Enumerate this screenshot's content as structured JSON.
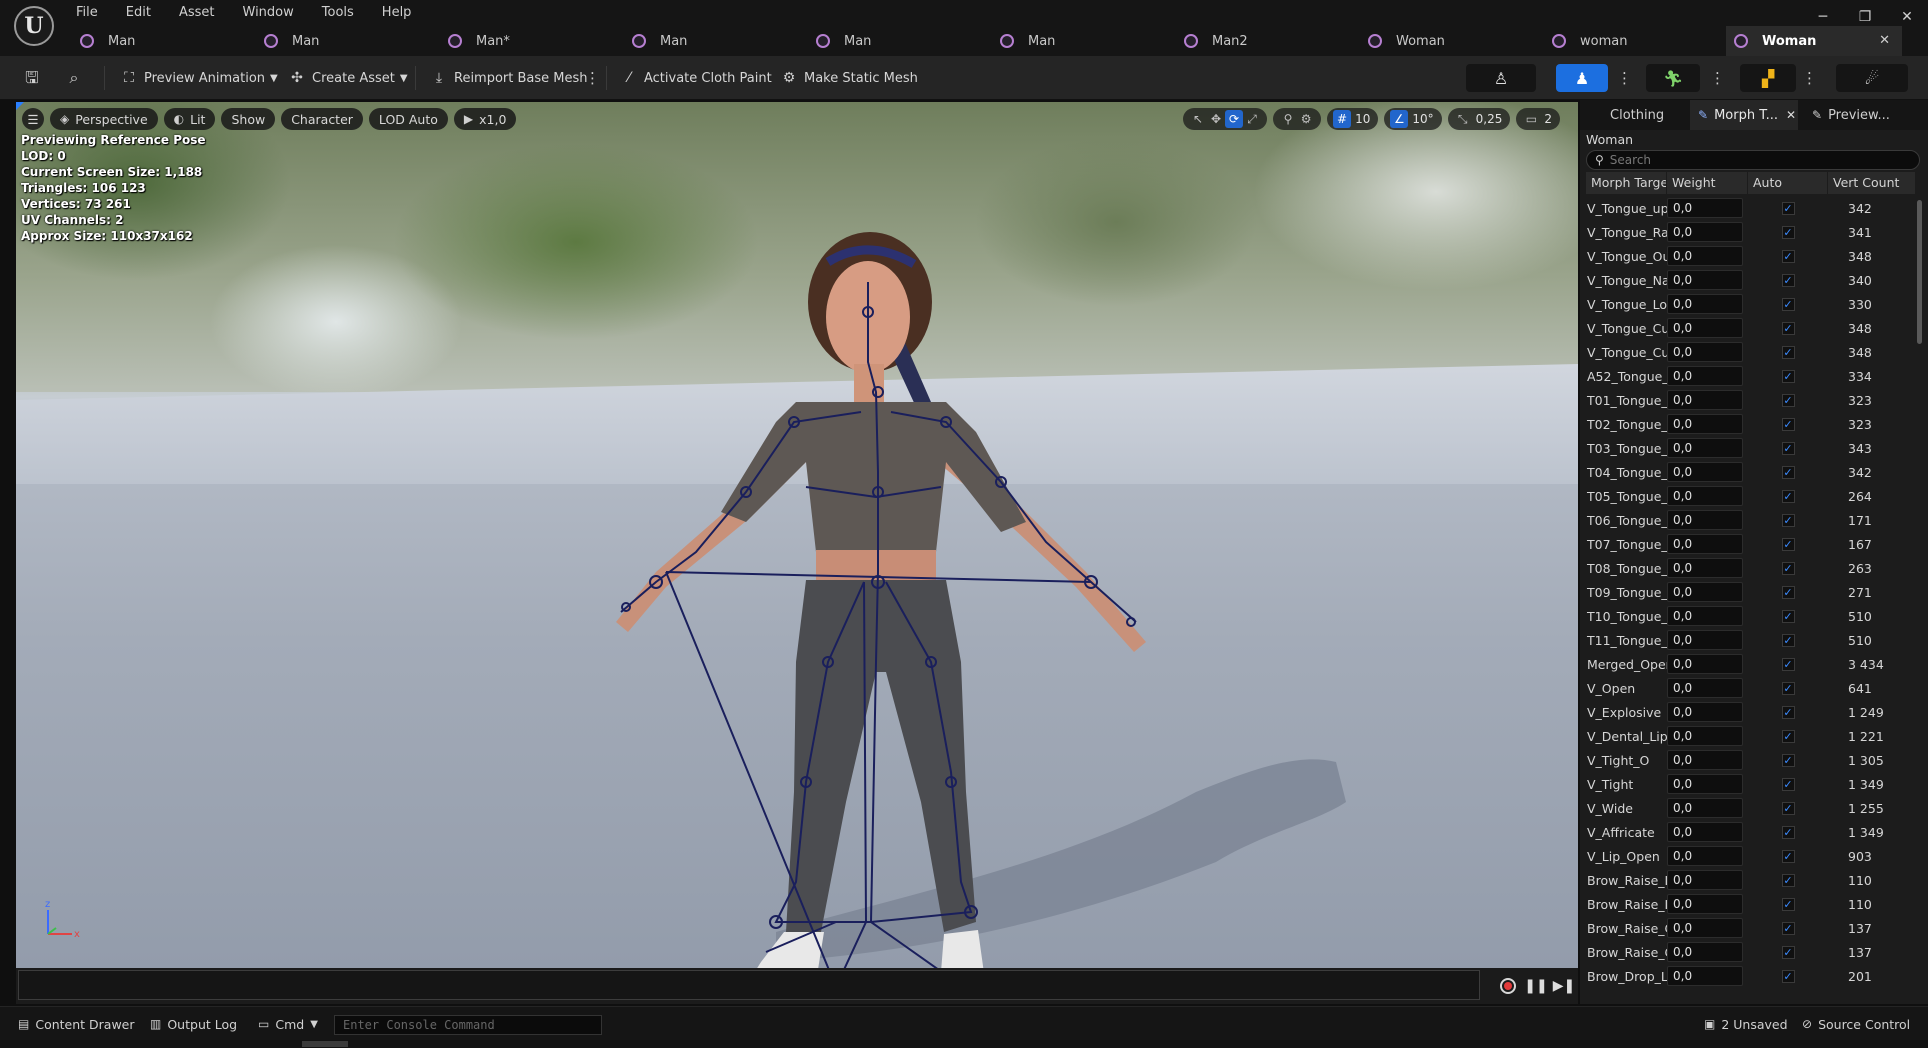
{
  "menu": [
    "File",
    "Edit",
    "Asset",
    "Window",
    "Tools",
    "Help"
  ],
  "window_controls": {
    "minimize": "─",
    "restore": "❐",
    "close": "✕"
  },
  "tabs": [
    {
      "label": "Man"
    },
    {
      "label": "Man"
    },
    {
      "label": "Man*"
    },
    {
      "label": "Man"
    },
    {
      "label": "Man"
    },
    {
      "label": "Man"
    },
    {
      "label": "Man2"
    },
    {
      "label": "Woman"
    },
    {
      "label": "woman"
    },
    {
      "label": "Woman",
      "active": true
    }
  ],
  "toolbar": {
    "preview_animation": "Preview Animation",
    "create_asset": "Create Asset",
    "reimport_base_mesh": "Reimport Base Mesh",
    "activate_cloth_paint": "Activate Cloth Paint",
    "make_static_mesh": "Make Static Mesh"
  },
  "viewport": {
    "chips": {
      "perspective": "Perspective",
      "lit": "Lit",
      "show": "Show",
      "character": "Character",
      "lod": "LOD Auto",
      "speed": "x1,0"
    },
    "grid_snap": "10",
    "rotation_snap": "10°",
    "scale_snap": "0,25",
    "camera_speed": "2",
    "info": [
      "Previewing Reference Pose",
      "LOD: 0",
      "Current Screen Size: 1,188",
      "Triangles: 106 123",
      "Vertices: 73 261",
      "UV Channels: 2",
      "Approx Size: 110x37x162"
    ]
  },
  "right_panel": {
    "tabs": {
      "clothing": "Clothing",
      "morph": "Morph T...",
      "preview": "Preview..."
    },
    "asset_name": "Woman",
    "search_placeholder": "Search",
    "columns": {
      "name": "Morph Targe",
      "weight": "Weight",
      "auto": "Auto",
      "vert": "Vert Count"
    },
    "rows": [
      {
        "name": "V_Tongue_up",
        "weight": "0,0",
        "auto": true,
        "vert": "342"
      },
      {
        "name": "V_Tongue_Rai",
        "weight": "0,0",
        "auto": true,
        "vert": "341"
      },
      {
        "name": "V_Tongue_Ou",
        "weight": "0,0",
        "auto": true,
        "vert": "348"
      },
      {
        "name": "V_Tongue_Na",
        "weight": "0,0",
        "auto": true,
        "vert": "340"
      },
      {
        "name": "V_Tongue_Lov",
        "weight": "0,0",
        "auto": true,
        "vert": "330"
      },
      {
        "name": "V_Tongue_Cui",
        "weight": "0,0",
        "auto": true,
        "vert": "348"
      },
      {
        "name": "V_Tongue_Cui",
        "weight": "0,0",
        "auto": true,
        "vert": "348"
      },
      {
        "name": "A52_Tongue_(",
        "weight": "0,0",
        "auto": true,
        "vert": "334"
      },
      {
        "name": "T01_Tongue_(",
        "weight": "0,0",
        "auto": true,
        "vert": "323"
      },
      {
        "name": "T02_Tongue_I",
        "weight": "0,0",
        "auto": true,
        "vert": "323"
      },
      {
        "name": "T03_Tongue_I",
        "weight": "0,0",
        "auto": true,
        "vert": "343"
      },
      {
        "name": "T04_Tongue_I",
        "weight": "0,0",
        "auto": true,
        "vert": "342"
      },
      {
        "name": "T05_Tongue_I",
        "weight": "0,0",
        "auto": true,
        "vert": "264"
      },
      {
        "name": "T06_Tongue_",
        "weight": "0,0",
        "auto": true,
        "vert": "171"
      },
      {
        "name": "T07_Tongue_",
        "weight": "0,0",
        "auto": true,
        "vert": "167"
      },
      {
        "name": "T08_Tongue_\\",
        "weight": "0,0",
        "auto": true,
        "vert": "263"
      },
      {
        "name": "T09_Tongue_",
        "weight": "0,0",
        "auto": true,
        "vert": "271"
      },
      {
        "name": "T10_Tongue_I",
        "weight": "0,0",
        "auto": true,
        "vert": "510"
      },
      {
        "name": "T11_Tongue_I",
        "weight": "0,0",
        "auto": true,
        "vert": "510"
      },
      {
        "name": "Merged_Open",
        "weight": "0,0",
        "auto": true,
        "vert": "3 434"
      },
      {
        "name": "V_Open",
        "weight": "0,0",
        "auto": true,
        "vert": "641"
      },
      {
        "name": "V_Explosive",
        "weight": "0,0",
        "auto": true,
        "vert": "1 249"
      },
      {
        "name": "V_Dental_Lip",
        "weight": "0,0",
        "auto": true,
        "vert": "1 221"
      },
      {
        "name": "V_Tight_O",
        "weight": "0,0",
        "auto": true,
        "vert": "1 305"
      },
      {
        "name": "V_Tight",
        "weight": "0,0",
        "auto": true,
        "vert": "1 349"
      },
      {
        "name": "V_Wide",
        "weight": "0,0",
        "auto": true,
        "vert": "1 255"
      },
      {
        "name": "V_Affricate",
        "weight": "0,0",
        "auto": true,
        "vert": "1 349"
      },
      {
        "name": "V_Lip_Open",
        "weight": "0,0",
        "auto": true,
        "vert": "903"
      },
      {
        "name": "Brow_Raise_I",
        "weight": "0,0",
        "auto": true,
        "vert": "110"
      },
      {
        "name": "Brow_Raise_I",
        "weight": "0,0",
        "auto": true,
        "vert": "110"
      },
      {
        "name": "Brow_Raise_C",
        "weight": "0,0",
        "auto": true,
        "vert": "137"
      },
      {
        "name": "Brow_Raise_C",
        "weight": "0,0",
        "auto": true,
        "vert": "137"
      },
      {
        "name": "Brow_Drop_Le",
        "weight": "0,0",
        "auto": true,
        "vert": "201"
      }
    ]
  },
  "statusbar": {
    "content_drawer": "Content Drawer",
    "output_log": "Output Log",
    "cmd": "Cmd",
    "console_placeholder": "Enter Console Command",
    "unsaved": "2 Unsaved",
    "source_control": "Source Control"
  },
  "colors": {
    "accent": "#1c6fe0",
    "tab_icon": "#b67fd1",
    "record": "#e23a3a",
    "bone": "#1a1f5c"
  }
}
